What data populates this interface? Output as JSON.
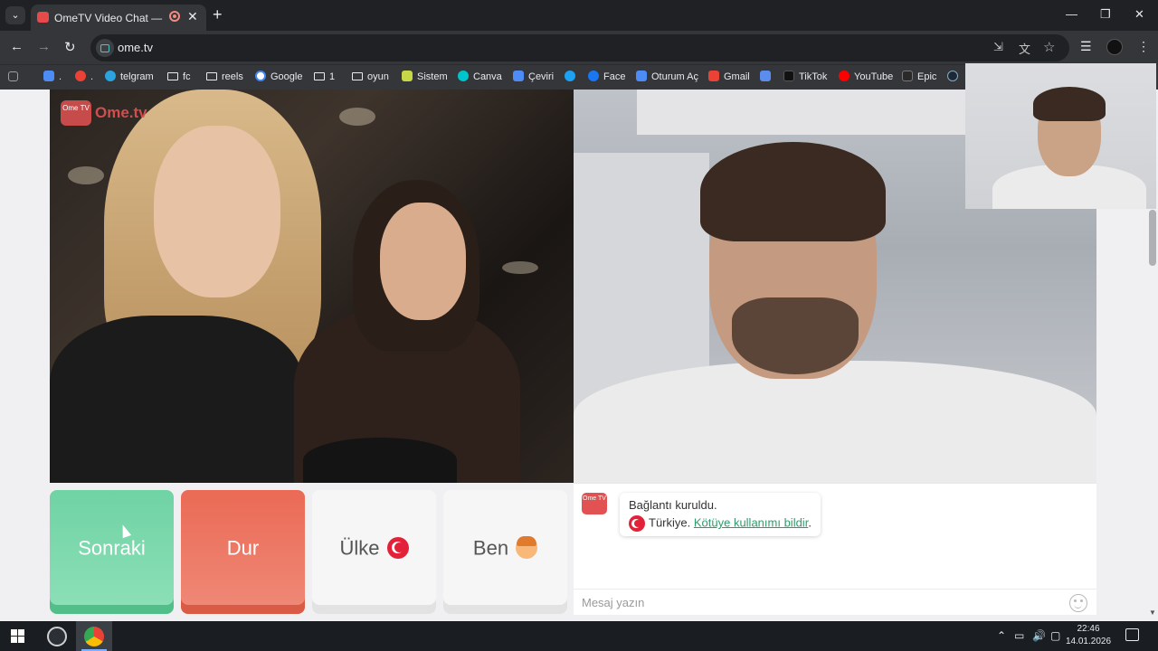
{
  "browser": {
    "tab_title": "OmeTV Video Chat — Ome",
    "tab_search_glyph": "⌄",
    "new_tab": "+",
    "close_tab": "✕",
    "url": "ome.tv",
    "window_controls": {
      "minimize": "—",
      "maximize": "❐",
      "close": "✕"
    },
    "nav": {
      "back": "←",
      "forward": "→",
      "reload": "↻"
    },
    "omnibox_icons": {
      "install": "⇲",
      "translate": "文",
      "bookmark": "☆"
    },
    "right_icons": {
      "media": "☰",
      "menu": "⋮"
    }
  },
  "bookmarks": [
    {
      "label": "",
      "icon": "apps-grid-icon",
      "color": "#9aa0a6"
    },
    {
      "label": ".",
      "icon": "screenshot-icon",
      "color": "#4d8bf5"
    },
    {
      "label": ".",
      "icon": "chrome-icon",
      "color": "#ea4335"
    },
    {
      "label": "telgram",
      "icon": "telegram-icon",
      "color": "#2aa3df"
    },
    {
      "label": "fc",
      "icon": "folder-icon",
      "color": ""
    },
    {
      "label": "reels",
      "icon": "folder-icon",
      "color": ""
    },
    {
      "label": "Google",
      "icon": "google-icon",
      "color": "#ffffff"
    },
    {
      "label": "1",
      "icon": "folder-icon",
      "color": ""
    },
    {
      "label": "oyun",
      "icon": "folder-icon",
      "color": ""
    },
    {
      "label": "Sistem",
      "icon": "vuetify-icon",
      "color": "#c7d847"
    },
    {
      "label": "Canva",
      "icon": "canva-icon",
      "color": "#00c4cc"
    },
    {
      "label": "Çeviri",
      "icon": "translate-icon",
      "color": "#4d8bf5"
    },
    {
      "label": "",
      "icon": "twitter-icon",
      "color": "#1da1f2"
    },
    {
      "label": "Face",
      "icon": "facebook-icon",
      "color": "#1877f2"
    },
    {
      "label": "Oturum Aç",
      "icon": "login-icon",
      "color": "#4d8bf5"
    },
    {
      "label": "Gmail",
      "icon": "gmail-icon",
      "color": "#ea4335"
    },
    {
      "label": "",
      "icon": "bookmark-app-icon",
      "color": "#5b8def"
    },
    {
      "label": "TikTok",
      "icon": "tiktok-icon",
      "color": "#111111"
    },
    {
      "label": "YouTube",
      "icon": "youtube-icon",
      "color": "#ff0000"
    },
    {
      "label": "Epic",
      "icon": "epic-icon",
      "color": "#2a2a2a"
    },
    {
      "label": "",
      "icon": "steam-icon",
      "color": "#1b2838"
    }
  ],
  "logo": {
    "tv_text": "Ome TV",
    "name": "Ome.tv"
  },
  "controls": {
    "next": "Sonraki",
    "stop": "Dur",
    "country": "Ülke",
    "me": "Ben"
  },
  "chat": {
    "logo_text": "Ome TV",
    "line1": "Bağlantı kuruldu.",
    "country": "Türkiye.",
    "report_link": "Kötüye kullanımı bildir",
    "after_link": ".",
    "input_placeholder": "Mesaj yazın"
  },
  "taskbar": {
    "time": "22:46",
    "date": "14.01.2026",
    "tray": {
      "chevron": "⌃",
      "battery": "▭",
      "volume": "🔊",
      "network": "▢"
    }
  },
  "colors": {
    "next": "#6fd3a4",
    "stop": "#ea6a55",
    "brand_red": "#e25252",
    "link_green": "#2e9c6a"
  }
}
